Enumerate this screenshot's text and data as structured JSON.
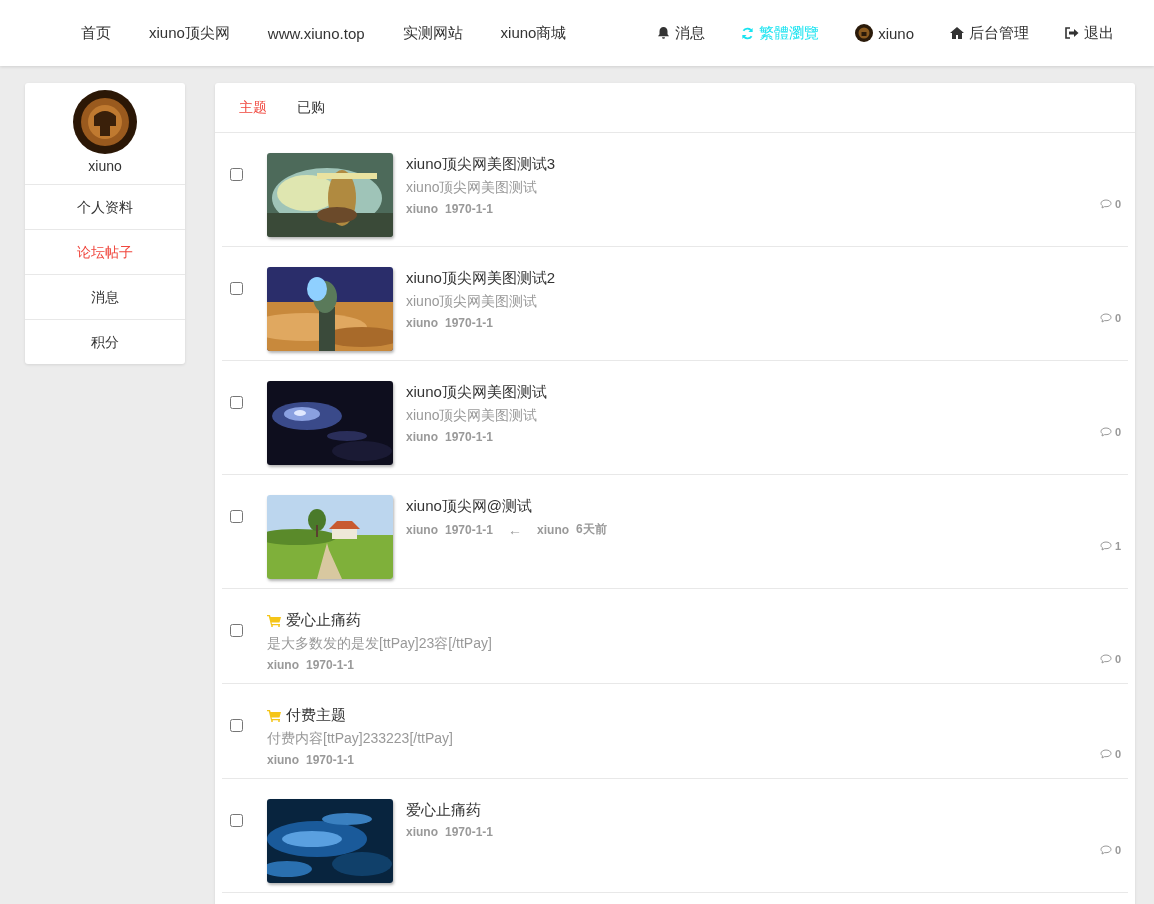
{
  "nav": {
    "links": [
      {
        "label": "首页"
      },
      {
        "label": "xiuno顶尖网"
      },
      {
        "label": "www.xiuno.top"
      },
      {
        "label": "实测网站"
      },
      {
        "label": "xiuno商城"
      }
    ],
    "actions": [
      {
        "kind": "bell",
        "label": "消息",
        "highlighted": false
      },
      {
        "kind": "refresh",
        "label": "繁體瀏覽",
        "highlighted": true
      },
      {
        "kind": "avatar",
        "label": "xiuno",
        "highlighted": false
      },
      {
        "kind": "home",
        "label": "后台管理",
        "highlighted": false
      },
      {
        "kind": "logout",
        "label": "退出",
        "highlighted": false
      }
    ]
  },
  "profile": {
    "username": "xiuno"
  },
  "sidebar": {
    "items": [
      {
        "label": "个人资料",
        "selected": false
      },
      {
        "label": "论坛帖子",
        "selected": true
      },
      {
        "label": "消息",
        "selected": false
      },
      {
        "label": "积分",
        "selected": false
      }
    ]
  },
  "tabs": [
    {
      "label": "主题",
      "selected": true
    },
    {
      "label": "已购",
      "selected": false
    }
  ],
  "threads": [
    {
      "kind": "picture",
      "checked": false,
      "title": "xiuno顶尖网美图测试3",
      "summary": "xiuno顶尖网美图测试",
      "author": "xiuno",
      "date": "1970-1-1",
      "comments": "0"
    },
    {
      "kind": "picture",
      "checked": false,
      "title": "xiuno顶尖网美图测试2",
      "summary": "xiuno顶尖网美图测试",
      "author": "xiuno",
      "date": "1970-1-1",
      "comments": "0"
    },
    {
      "kind": "picture",
      "checked": false,
      "title": "xiuno顶尖网美图测试",
      "summary": "xiuno顶尖网美图测试",
      "author": "xiuno",
      "date": "1970-1-1",
      "comments": "0"
    },
    {
      "kind": "picture",
      "checked": false,
      "title": "xiuno顶尖网@测试",
      "author": "xiuno",
      "date": "1970-1-1",
      "reply_arrow": "←",
      "last_replier": "xiuno",
      "last_reply_time": "6天前",
      "comments": "1"
    },
    {
      "kind": "paid",
      "checked": false,
      "title": "爱心止痛药",
      "summary": "是大多数发的是发[ttPay]23容[/ttPay]",
      "author": "xiuno",
      "date": "1970-1-1",
      "comments": "0"
    },
    {
      "kind": "paid",
      "checked": false,
      "title": "付费主题",
      "summary": "付费内容[ttPay]233223[/ttPay]",
      "author": "xiuno",
      "date": "1970-1-1",
      "comments": "0"
    },
    {
      "kind": "picture",
      "checked": false,
      "title": "爱心止痛药",
      "author": "xiuno",
      "date": "1970-1-1",
      "comments": "0"
    }
  ]
}
